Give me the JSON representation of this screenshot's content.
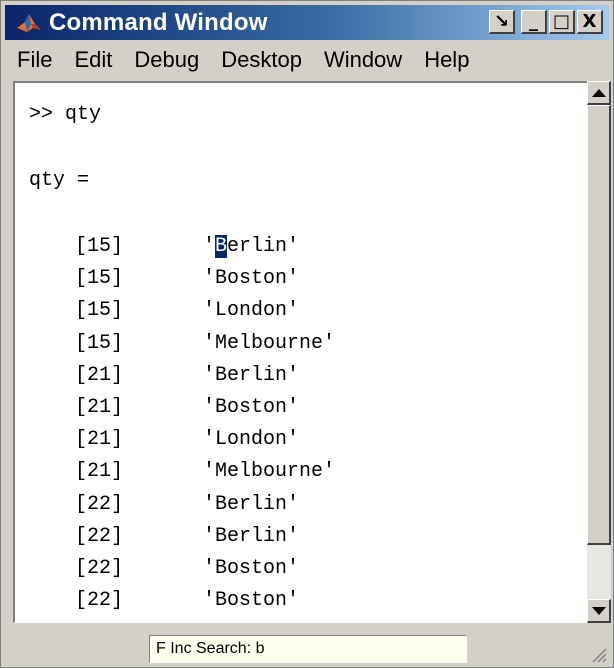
{
  "window": {
    "title": "Command Window",
    "buttons": {
      "undock": "↘",
      "minimize": "_",
      "maximize": "□",
      "close": "X"
    }
  },
  "menu": [
    "File",
    "Edit",
    "Debug",
    "Desktop",
    "Window",
    "Help"
  ],
  "console": {
    "prompt_line": ">> qty",
    "output_header": "qty =",
    "rows": [
      {
        "num": "[15]",
        "city": "'Berlin'"
      },
      {
        "num": "[15]",
        "city": "'Boston'"
      },
      {
        "num": "[15]",
        "city": "'London'"
      },
      {
        "num": "[15]",
        "city": "'Melbourne'"
      },
      {
        "num": "[21]",
        "city": "'Berlin'"
      },
      {
        "num": "[21]",
        "city": "'Boston'"
      },
      {
        "num": "[21]",
        "city": "'London'"
      },
      {
        "num": "[21]",
        "city": "'Melbourne'"
      },
      {
        "num": "[22]",
        "city": "'Berlin'"
      },
      {
        "num": "[22]",
        "city": "'Berlin'"
      },
      {
        "num": "[22]",
        "city": "'Boston'"
      },
      {
        "num": "[22]",
        "city": "'Boston'"
      }
    ],
    "highlight": {
      "row": 0,
      "char_index": 1
    }
  },
  "status": {
    "text": "F Inc Search: b"
  },
  "icons": {
    "app": "matlab-logo-icon",
    "scroll_up": "arrow-up-icon",
    "scroll_down": "arrow-down-icon",
    "grip": "resize-grip-icon"
  },
  "colors": {
    "title_start": "#0a246a",
    "title_end": "#a6caf0",
    "highlight_bg": "#0a246a"
  }
}
